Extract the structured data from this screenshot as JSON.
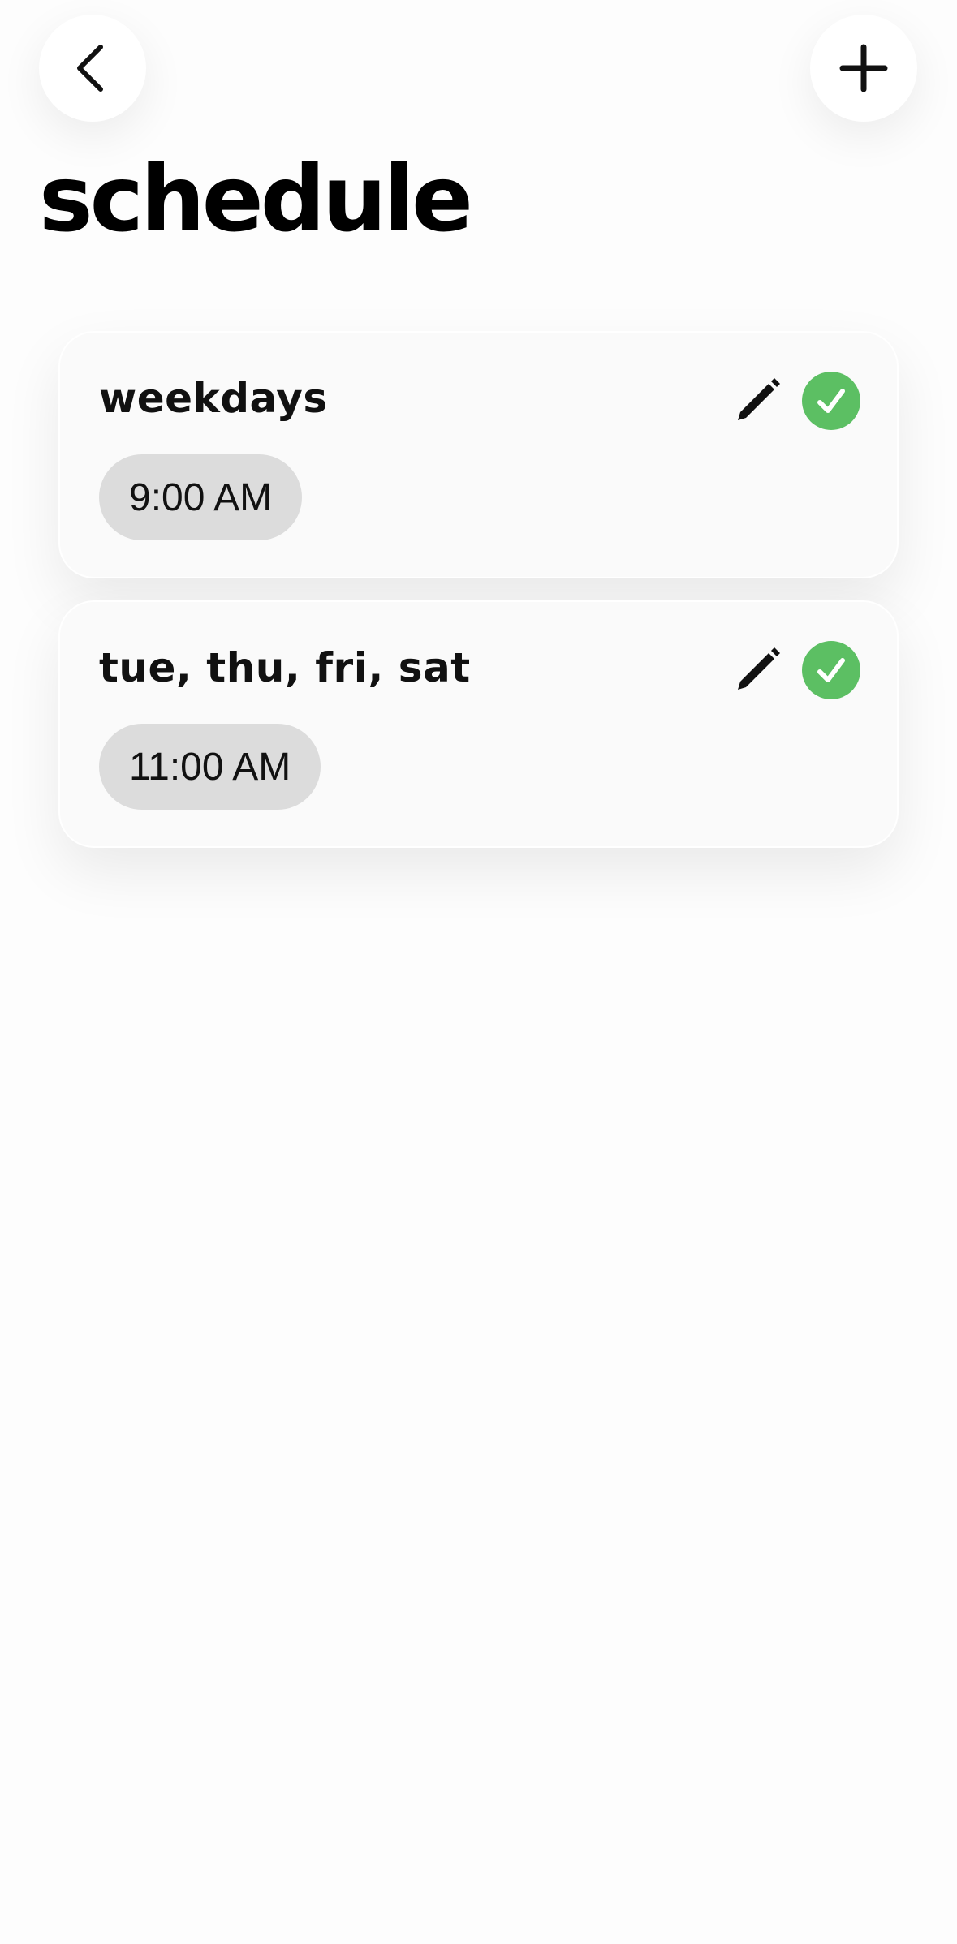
{
  "header": {
    "back_icon": "chevron-left-icon",
    "add_icon": "plus-icon",
    "title": "schedule"
  },
  "colors": {
    "accent_green": "#5cbf63",
    "chip_background": "#dcdcdc",
    "card_background": "#fafafa"
  },
  "schedules": [
    {
      "title": "weekdays",
      "time": "9:00 AM",
      "enabled": true,
      "edit_icon": "pencil-icon",
      "status_icon": "check-circle-icon"
    },
    {
      "title": "tue, thu, fri, sat",
      "time": "11:00 AM",
      "enabled": true,
      "edit_icon": "pencil-icon",
      "status_icon": "check-circle-icon"
    }
  ]
}
